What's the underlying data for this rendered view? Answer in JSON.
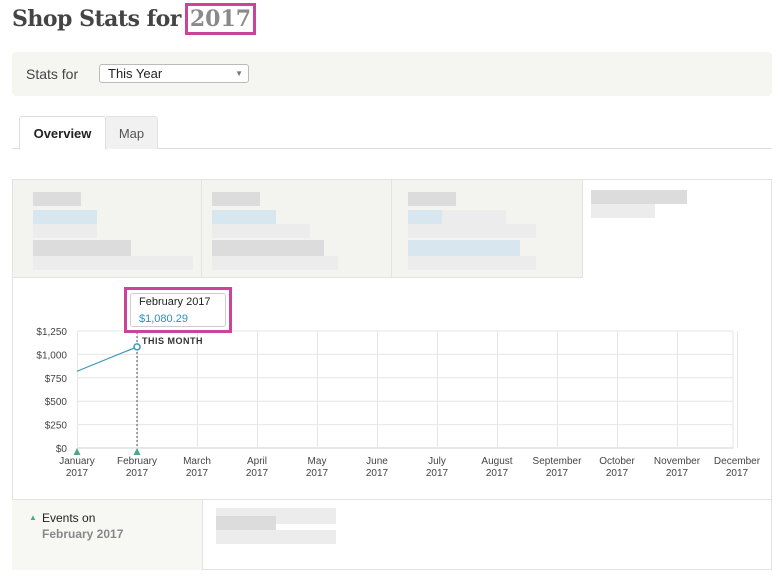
{
  "header": {
    "title": "Shop Stats for",
    "year": "2017"
  },
  "stats_bar": {
    "label": "Stats for",
    "select_value": "This Year"
  },
  "tabs": [
    {
      "label": "Overview",
      "active": true
    },
    {
      "label": "Map",
      "active": false
    }
  ],
  "tooltip": {
    "date": "February 2017",
    "value": "$1,080.29"
  },
  "events": {
    "title": "Events on",
    "date": "February 2017"
  },
  "colors": {
    "highlight": "#c9449a",
    "series": "#3a96bb",
    "event_marker": "#4aa88e"
  },
  "chart_data": {
    "type": "line",
    "x": [
      "January 2017",
      "February 2017",
      "March 2017",
      "April 2017",
      "May 2017",
      "June 2017",
      "July 2017",
      "August 2017",
      "September 2017",
      "October 2017",
      "November 2017",
      "December 2017"
    ],
    "x_ticks": [
      [
        "January",
        "2017"
      ],
      [
        "February",
        "2017"
      ],
      [
        "March",
        "2017"
      ],
      [
        "April",
        "2017"
      ],
      [
        "May",
        "2017"
      ],
      [
        "June",
        "2017"
      ],
      [
        "July",
        "2017"
      ],
      [
        "August",
        "2017"
      ],
      [
        "September",
        "2017"
      ],
      [
        "October",
        "2017"
      ],
      [
        "November",
        "2017"
      ],
      [
        "December",
        "2017"
      ]
    ],
    "y_ticks": [
      "$0",
      "$250",
      "$500",
      "$750",
      "$1,000",
      "$1,250"
    ],
    "y_tick_values": [
      0,
      250,
      500,
      750,
      1000,
      1250
    ],
    "ylim": [
      0,
      1250
    ],
    "series": [
      {
        "values": [
          820,
          1080.29
        ]
      }
    ],
    "events": [
      "January 2017",
      "February 2017"
    ],
    "annotation": "THIS MONTH",
    "current_index": 1,
    "grid": true
  }
}
